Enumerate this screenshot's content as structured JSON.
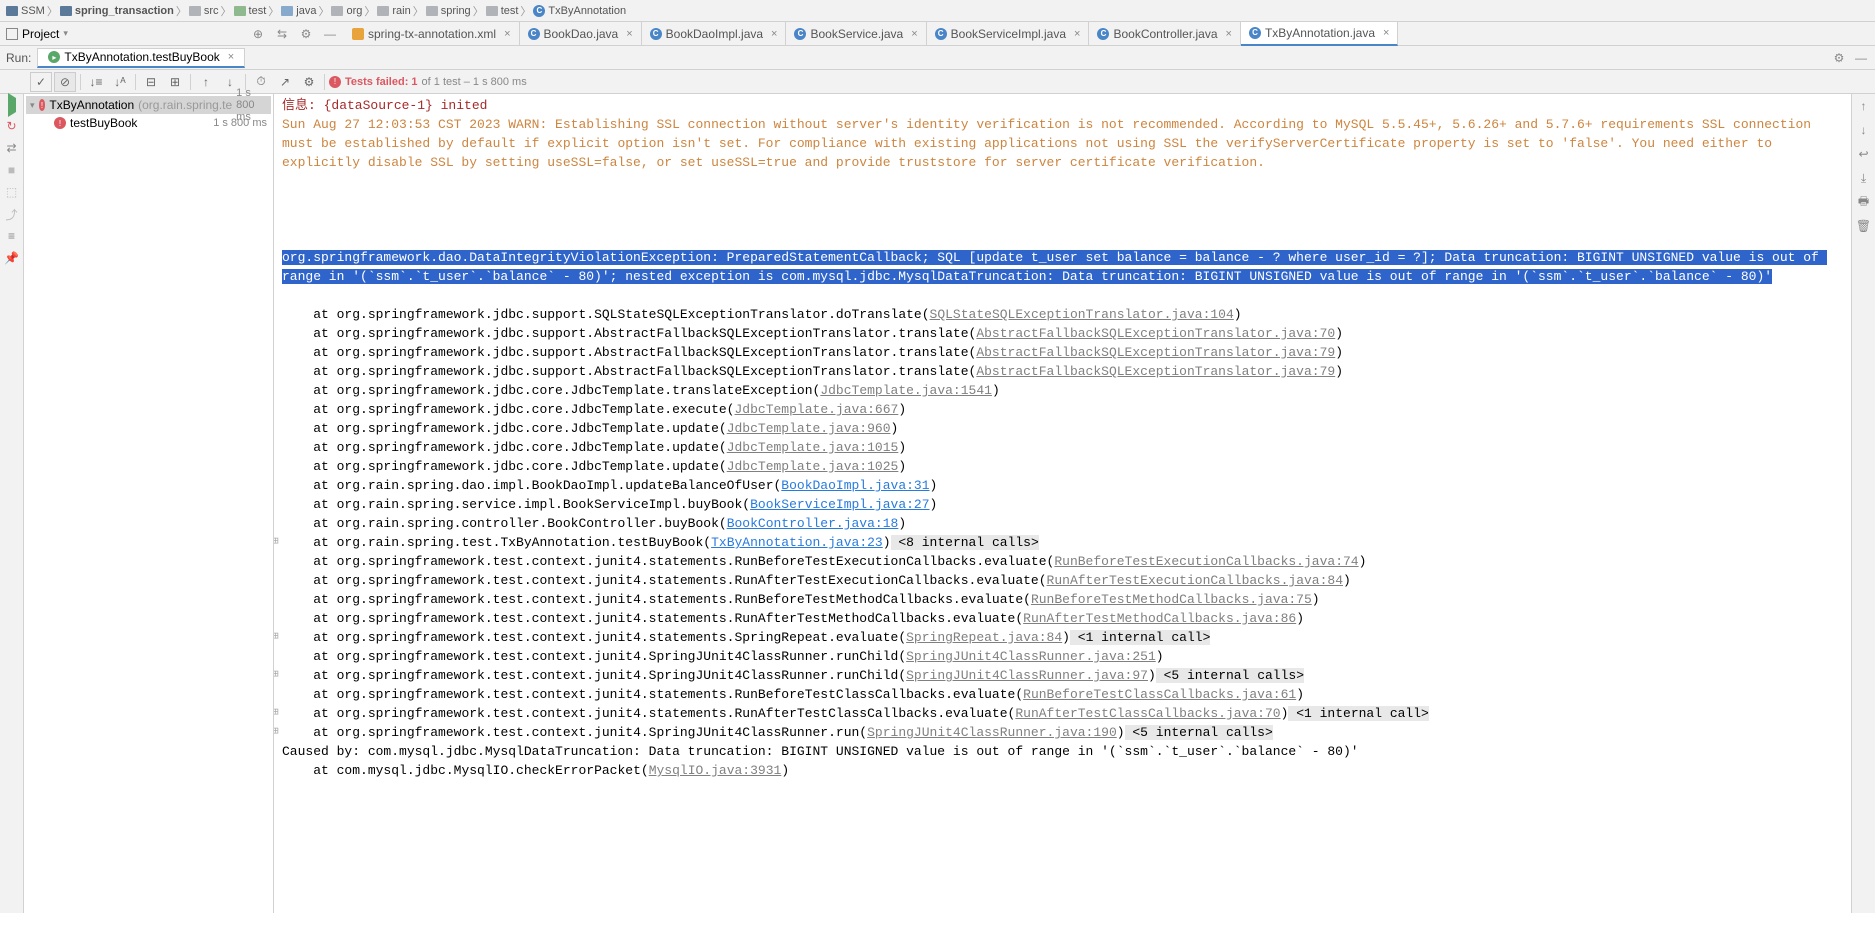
{
  "breadcrumb": [
    {
      "type": "folder",
      "cls": "navy",
      "label": "SSM"
    },
    {
      "type": "folder",
      "cls": "navy",
      "label": "spring_transaction"
    },
    {
      "type": "folder",
      "cls": "",
      "label": "src"
    },
    {
      "type": "folder",
      "cls": "green",
      "label": "test"
    },
    {
      "type": "folder",
      "cls": "blue",
      "label": "java"
    },
    {
      "type": "folder",
      "cls": "",
      "label": "org"
    },
    {
      "type": "folder",
      "cls": "",
      "label": "rain"
    },
    {
      "type": "folder",
      "cls": "",
      "label": "spring"
    },
    {
      "type": "folder",
      "cls": "",
      "label": "test"
    },
    {
      "type": "class",
      "label": "TxByAnnotation"
    }
  ],
  "projectLabel": "Project",
  "editorTabs": [
    {
      "icon": "xml",
      "label": "spring-tx-annotation.xml",
      "active": false
    },
    {
      "icon": "class",
      "label": "BookDao.java",
      "active": false
    },
    {
      "icon": "class",
      "label": "BookDaoImpl.java",
      "active": false
    },
    {
      "icon": "class",
      "label": "BookService.java",
      "active": false
    },
    {
      "icon": "class",
      "label": "BookServiceImpl.java",
      "active": false
    },
    {
      "icon": "class",
      "label": "BookController.java",
      "active": false
    },
    {
      "icon": "class",
      "label": "TxByAnnotation.java",
      "active": true
    }
  ],
  "runLabel": "Run:",
  "runTab": "TxByAnnotation.testBuyBook",
  "testsFailedLabel": "Tests failed: 1",
  "testsFailedTail": " of 1 test – 1 s 800 ms",
  "treeRoot": {
    "name": "TxByAnnotation",
    "pkg": "(org.rain.spring.te",
    "time": "1 s 800 ms"
  },
  "treeChild": {
    "name": "testBuyBook",
    "time": "1 s 800 ms"
  },
  "console": {
    "info": "信息: {dataSource-1} inited",
    "warn": "Sun Aug 27 12:03:53 CST 2023 WARN: Establishing SSL connection without server's identity verification is not recommended. According to MySQL 5.5.45+, 5.6.26+ and 5.7.6+ requirements SSL connection must be established by default if explicit option isn't set. For compliance with existing applications not using SSL the verifyServerCertificate property is set to 'false'. You need either to explicitly disable SSL by setting useSSL=false, or set useSSL=true and provide truststore for server certificate verification.",
    "exception": "org.springframework.dao.DataIntegrityViolationException: PreparedStatementCallback; SQL [update t_user set balance = balance - ? where user_id = ?]; Data truncation: BIGINT UNSIGNED value is out of range in '(`ssm`.`t_user`.`balance` - 80)'; nested exception is com.mysql.jdbc.MysqlDataTruncation: Data truncation: BIGINT UNSIGNED value is out of range in '(`ssm`.`t_user`.`balance` - 80)'",
    "stack": [
      {
        "pre": "at org.springframework.jdbc.support.SQLStateSQLExceptionTranslator.doTranslate(",
        "link": "SQLStateSQLExceptionTranslator.java:104",
        "lt": "gray",
        "post": ")"
      },
      {
        "pre": "at org.springframework.jdbc.support.AbstractFallbackSQLExceptionTranslator.translate(",
        "link": "AbstractFallbackSQLExceptionTranslator.java:70",
        "lt": "gray",
        "post": ")"
      },
      {
        "pre": "at org.springframework.jdbc.support.AbstractFallbackSQLExceptionTranslator.translate(",
        "link": "AbstractFallbackSQLExceptionTranslator.java:79",
        "lt": "gray",
        "post": ")"
      },
      {
        "pre": "at org.springframework.jdbc.support.AbstractFallbackSQLExceptionTranslator.translate(",
        "link": "AbstractFallbackSQLExceptionTranslator.java:79",
        "lt": "gray",
        "post": ")"
      },
      {
        "pre": "at org.springframework.jdbc.core.JdbcTemplate.translateException(",
        "link": "JdbcTemplate.java:1541",
        "lt": "gray",
        "post": ")"
      },
      {
        "pre": "at org.springframework.jdbc.core.JdbcTemplate.execute(",
        "link": "JdbcTemplate.java:667",
        "lt": "gray",
        "post": ")"
      },
      {
        "pre": "at org.springframework.jdbc.core.JdbcTemplate.update(",
        "link": "JdbcTemplate.java:960",
        "lt": "gray",
        "post": ")"
      },
      {
        "pre": "at org.springframework.jdbc.core.JdbcTemplate.update(",
        "link": "JdbcTemplate.java:1015",
        "lt": "gray",
        "post": ")"
      },
      {
        "pre": "at org.springframework.jdbc.core.JdbcTemplate.update(",
        "link": "JdbcTemplate.java:1025",
        "lt": "gray",
        "post": ")"
      },
      {
        "pre": "at org.rain.spring.dao.impl.BookDaoImpl.updateBalanceOfUser(",
        "link": "BookDaoImpl.java:31",
        "lt": "blue",
        "post": ")"
      },
      {
        "pre": "at org.rain.spring.service.impl.BookServiceImpl.buyBook(",
        "link": "BookServiceImpl.java:27",
        "lt": "blue",
        "post": ")"
      },
      {
        "pre": "at org.rain.spring.controller.BookController.buyBook(",
        "link": "BookController.java:18",
        "lt": "blue",
        "post": ")"
      },
      {
        "pre": "at org.rain.spring.test.TxByAnnotation.testBuyBook(",
        "link": "TxByAnnotation.java:23",
        "lt": "blue",
        "post": ")",
        "tail": " <8 internal calls>",
        "fold": "+"
      },
      {
        "pre": "at org.springframework.test.context.junit4.statements.RunBeforeTestExecutionCallbacks.evaluate(",
        "link": "RunBeforeTestExecutionCallbacks.java:74",
        "lt": "gray",
        "post": ")"
      },
      {
        "pre": "at org.springframework.test.context.junit4.statements.RunAfterTestExecutionCallbacks.evaluate(",
        "link": "RunAfterTestExecutionCallbacks.java:84",
        "lt": "gray",
        "post": ")"
      },
      {
        "pre": "at org.springframework.test.context.junit4.statements.RunBeforeTestMethodCallbacks.evaluate(",
        "link": "RunBeforeTestMethodCallbacks.java:75",
        "lt": "gray",
        "post": ")"
      },
      {
        "pre": "at org.springframework.test.context.junit4.statements.RunAfterTestMethodCallbacks.evaluate(",
        "link": "RunAfterTestMethodCallbacks.java:86",
        "lt": "gray",
        "post": ")"
      },
      {
        "pre": "at org.springframework.test.context.junit4.statements.SpringRepeat.evaluate(",
        "link": "SpringRepeat.java:84",
        "lt": "gray",
        "post": ")",
        "tail": " <1 internal call>",
        "fold": "+"
      },
      {
        "pre": "at org.springframework.test.context.junit4.SpringJUnit4ClassRunner.runChild(",
        "link": "SpringJUnit4ClassRunner.java:251",
        "lt": "gray",
        "post": ")"
      },
      {
        "pre": "at org.springframework.test.context.junit4.SpringJUnit4ClassRunner.runChild(",
        "link": "SpringJUnit4ClassRunner.java:97",
        "lt": "gray",
        "post": ")",
        "tail": " <5 internal calls>",
        "fold": "+"
      },
      {
        "pre": "at org.springframework.test.context.junit4.statements.RunBeforeTestClassCallbacks.evaluate(",
        "link": "RunBeforeTestClassCallbacks.java:61",
        "lt": "gray",
        "post": ")"
      },
      {
        "pre": "at org.springframework.test.context.junit4.statements.RunAfterTestClassCallbacks.evaluate(",
        "link": "RunAfterTestClassCallbacks.java:70",
        "lt": "gray",
        "post": ")",
        "tail": " <1 internal call>",
        "fold": "+"
      },
      {
        "pre": "at org.springframework.test.context.junit4.SpringJUnit4ClassRunner.run(",
        "link": "SpringJUnit4ClassRunner.java:190",
        "lt": "gray",
        "post": ")",
        "tail": " <5 internal calls>",
        "fold": "+"
      }
    ],
    "causedBy": "Caused by: com.mysql.jdbc.MysqlDataTruncation: Data truncation: BIGINT UNSIGNED value is out of range in '(`ssm`.`t_user`.`balance` - 80)'",
    "causedStack": {
      "pre": "at com.mysql.jdbc.MysqlIO.checkErrorPacket(",
      "link": "MysqlIO.java:3931",
      "lt": "gray",
      "post": ")"
    }
  }
}
